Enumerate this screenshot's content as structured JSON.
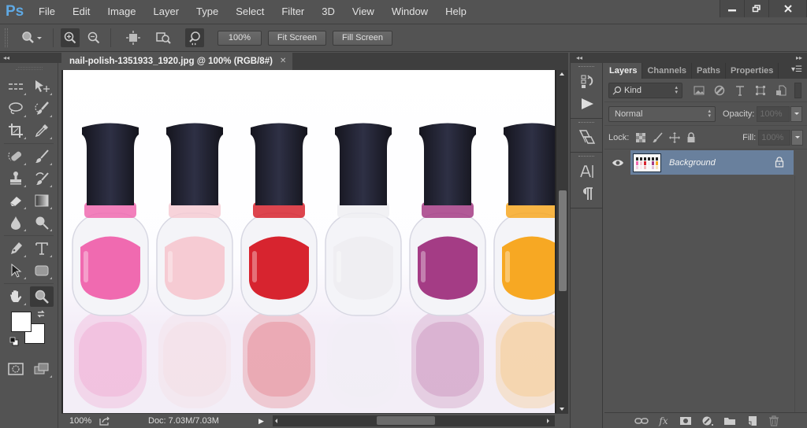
{
  "app": {
    "logo": "Ps",
    "menu": [
      "File",
      "Edit",
      "Image",
      "Layer",
      "Type",
      "Select",
      "Filter",
      "3D",
      "View",
      "Window",
      "Help"
    ],
    "window_controls": {
      "minimize": "minimize-icon",
      "restore": "restore-icon",
      "close": "close-icon"
    }
  },
  "options_bar": {
    "tool_icon": "zoom-tool-icon",
    "buttons": {
      "zoom_100": "100%",
      "fit_screen": "Fit Screen",
      "fill_screen": "Fill Screen"
    },
    "icons": [
      "zoom-in-icon",
      "zoom-out-icon",
      "resize-windows-icon",
      "zoom-all-windows-icon",
      "scrubby-zoom-icon"
    ]
  },
  "toolbar": {
    "tools": [
      [
        "rectangular-marquee",
        "move"
      ],
      [
        "lasso",
        "quick-selection"
      ],
      [
        "crop",
        "eyedropper"
      ],
      [
        "spot-healing-brush",
        "brush"
      ],
      [
        "clone-stamp",
        "history-brush"
      ],
      [
        "eraser",
        "gradient"
      ],
      [
        "blur",
        "dodge"
      ],
      [
        "pen",
        "type"
      ],
      [
        "path-selection",
        "rectangle"
      ],
      [
        "hand",
        "zoom"
      ]
    ],
    "active_tool": "zoom",
    "foreground_color": "#ffffff",
    "background_color": "#ffffff"
  },
  "document": {
    "tab_title": "nail-polish-1351933_1920.jpg @ 100% (RGB/8#)",
    "bottles": [
      {
        "name": "hot-pink",
        "color": "#f06ab0"
      },
      {
        "name": "pale-pink",
        "color": "#f6cbd3"
      },
      {
        "name": "red",
        "color": "#d7242f"
      },
      {
        "name": "white",
        "color": "#efeef2"
      },
      {
        "name": "magenta",
        "color": "#a43c85"
      },
      {
        "name": "orange",
        "color": "#f7a823"
      }
    ]
  },
  "status_bar": {
    "zoom": "100%",
    "doc_size": "Doc: 7.03M/7.03M"
  },
  "dock": {
    "icons": [
      "history-icon",
      "actions-play-icon",
      "clone-source-icon",
      "character-icon",
      "paragraph-icon"
    ]
  },
  "layers_panel": {
    "tabs": [
      "Layers",
      "Channels",
      "Paths",
      "Properties"
    ],
    "active_tab": "Layers",
    "filter_kind": "Kind",
    "blend_mode": "Normal",
    "opacity_label": "Opacity:",
    "opacity_value": "100%",
    "lock_label": "Lock:",
    "fill_label": "Fill:",
    "fill_value": "100%",
    "layers": [
      {
        "name": "Background",
        "visible": true,
        "locked": true,
        "selected": true
      }
    ],
    "footer_icons": [
      "link-layers-icon",
      "fx-icon",
      "add-mask-icon",
      "adjustment-layer-icon",
      "new-group-icon",
      "new-layer-icon",
      "delete-layer-icon"
    ]
  }
}
